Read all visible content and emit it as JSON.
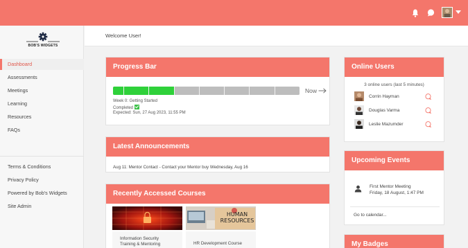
{
  "header": {
    "icons": [
      "bell-icon",
      "chat-bubble-icon",
      "avatar",
      "chevron-down-icon"
    ],
    "accent_color": "#f4766b"
  },
  "brand": {
    "logo_text": "BOB'S WIDGETS"
  },
  "sidebar": {
    "items": [
      {
        "label": "Dashboard",
        "active": true
      },
      {
        "label": "Assessments"
      },
      {
        "label": "Meetings"
      },
      {
        "label": "Learning"
      },
      {
        "label": "Resources"
      },
      {
        "label": "FAQs"
      }
    ],
    "footer_items": [
      {
        "label": "Terms & Conditions"
      },
      {
        "label": "Privacy Policy"
      },
      {
        "label": "Powered by Bob's Widgets"
      },
      {
        "label": "Site Admin"
      }
    ]
  },
  "welcome": "Welcome User!",
  "progress": {
    "title": "Progress Bar",
    "completed_segments": 2,
    "total_segments": 7,
    "now_label": "Now",
    "week_line": "Week 0: Getting Started",
    "completed_label": "Completed",
    "expected": "Expected: Sun, 27 Aug 2023, 11:55 PM",
    "fill_color": "#2fd13a"
  },
  "announcements": {
    "title": "Latest Announcements",
    "items": [
      "Aug 11: Mentor Contact - Contact your Mentor buy Wednesday, Aug 16"
    ]
  },
  "courses": {
    "title": "Recently Accessed Courses",
    "items": [
      {
        "title_line1": "Information Security",
        "title_line2": "Training & Mentoring"
      },
      {
        "title_line1": "HR Development Course",
        "thumb_line1": "HUMAN",
        "thumb_line2": "RESOURCES"
      }
    ]
  },
  "online_users": {
    "title": "Online Users",
    "subtitle": "3 online users (last 5 minutes)",
    "users": [
      {
        "name": "Corrin Hayman"
      },
      {
        "name": "Douglas Varma"
      },
      {
        "name": "Leslie Mazumder"
      }
    ]
  },
  "events": {
    "title": "Upcoming Events",
    "items": [
      {
        "title": "First Mentor Meeting",
        "date": "Friday, 18 August, 1:47 PM"
      }
    ],
    "calendar_link": "Go to calendar..."
  },
  "badges": {
    "title": "My Badges"
  }
}
